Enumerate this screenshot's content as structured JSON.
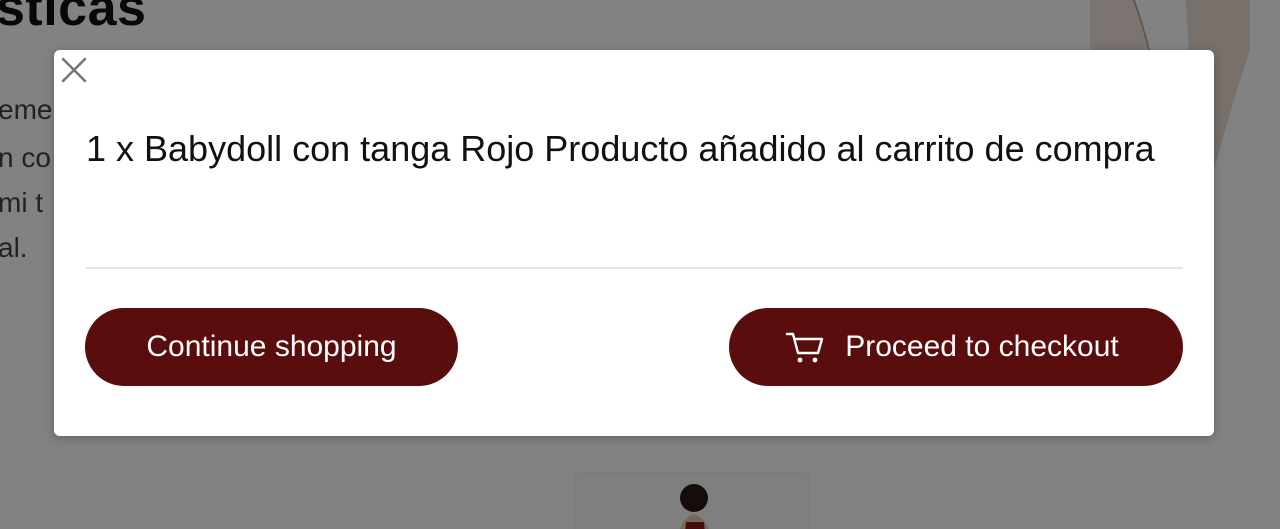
{
  "background": {
    "heading": "sticas",
    "lines": [
      "eme",
      "n co",
      "mi t",
      "al."
    ]
  },
  "modal": {
    "close_icon": "close-icon",
    "message": "1 x Babydoll con tanga Rojo Producto añadido al carrito de compra",
    "continue_label": "Continue shopping",
    "checkout_label": "Proceed to checkout",
    "checkout_icon": "cart-icon"
  },
  "colors": {
    "button": "#5a0d0d",
    "overlay": "rgba(0,0,0,0.49)",
    "modal_bg": "#ffffff"
  }
}
